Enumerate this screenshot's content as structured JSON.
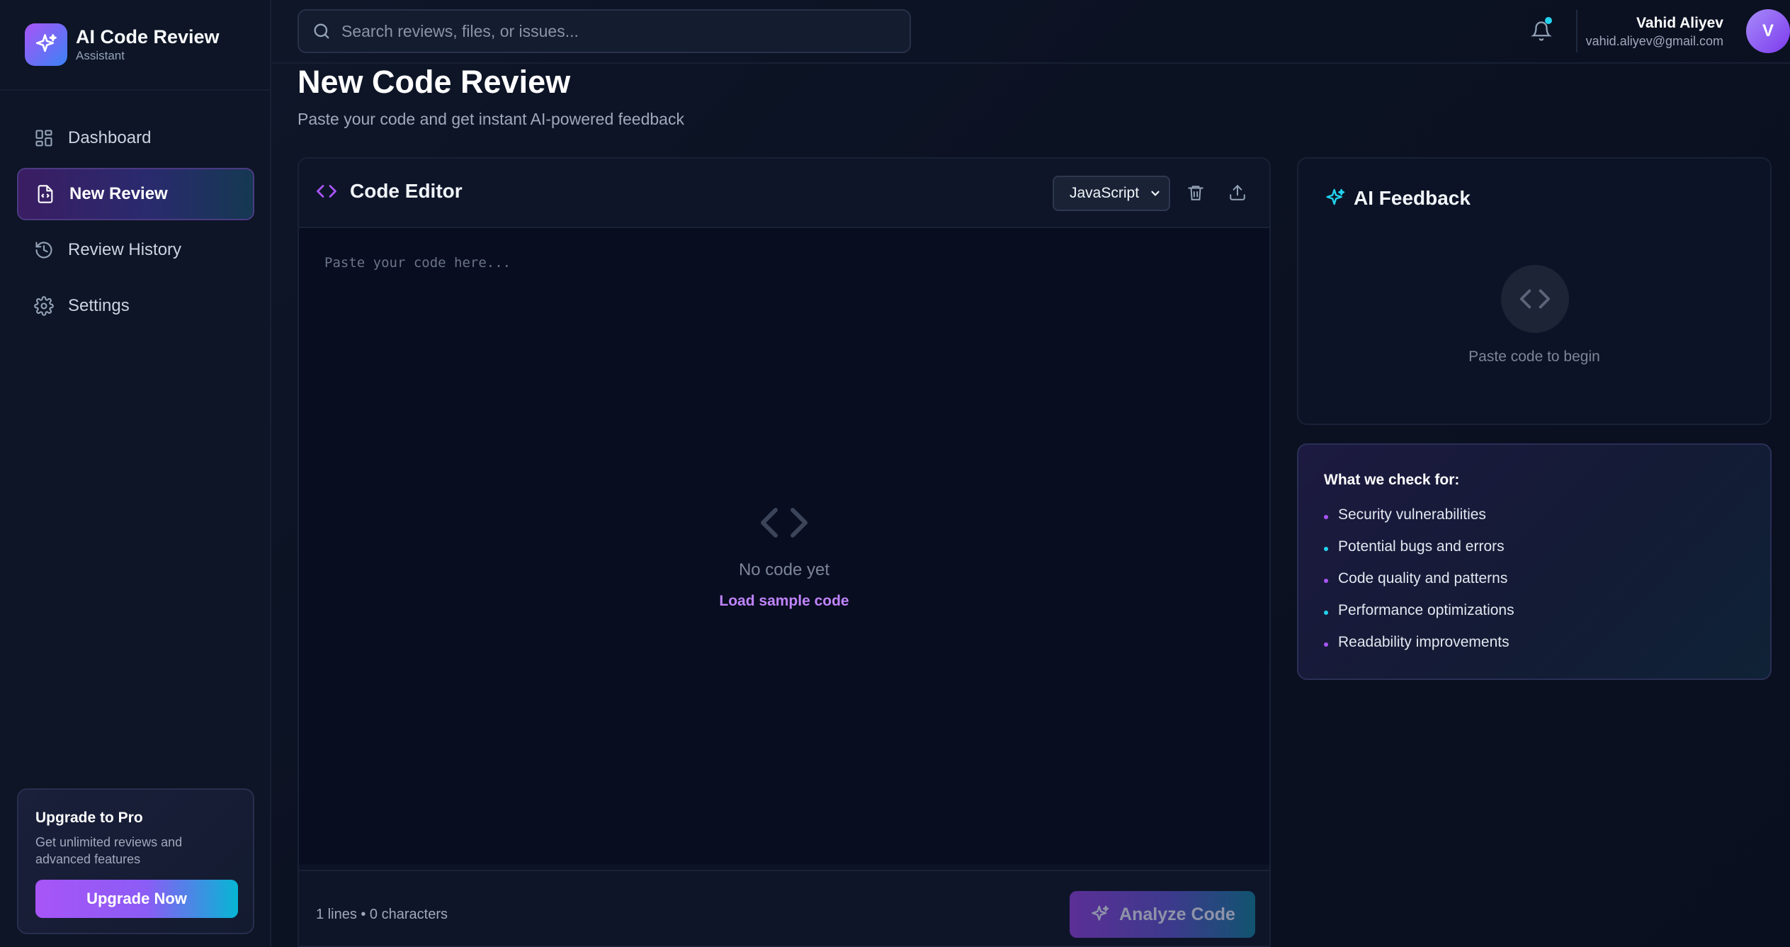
{
  "brand": {
    "title": "AI Code Review",
    "subtitle": "Assistant"
  },
  "sidebar": {
    "items": [
      {
        "label": "Dashboard",
        "icon": "dashboard-icon",
        "active": false
      },
      {
        "label": "New Review",
        "icon": "file-code-icon",
        "active": true
      },
      {
        "label": "Review History",
        "icon": "history-icon",
        "active": false
      },
      {
        "label": "Settings",
        "icon": "gear-icon",
        "active": false
      }
    ],
    "upgrade": {
      "title": "Upgrade to Pro",
      "description": "Get unlimited reviews and advanced features",
      "button_label": "Upgrade Now"
    }
  },
  "topbar": {
    "search_placeholder": "Search reviews, files, or issues...",
    "user": {
      "name": "Vahid Aliyev",
      "email": "vahid.aliyev@gmail.com",
      "initial": "V"
    }
  },
  "main": {
    "title": "New Code Review",
    "subtitle": "Paste your code and get instant AI-powered feedback"
  },
  "editor": {
    "title": "Code Editor",
    "language": "JavaScript",
    "placeholder": "Paste your code here...",
    "empty_title": "No code yet",
    "empty_link": "Load sample code",
    "stats": "1 lines • 0 characters",
    "analyze_label": "Analyze Code"
  },
  "feedback": {
    "title": "AI Feedback",
    "empty_text": "Paste code to begin"
  },
  "checks": {
    "title": "What we check for:",
    "items": [
      "Security vulnerabilities",
      "Potential bugs and errors",
      "Code quality and patterns",
      "Performance optimizations",
      "Readability improvements"
    ]
  },
  "colors": {
    "accent_purple": "#a855f7",
    "accent_cyan": "#06b6d4",
    "background": "#0b1120",
    "link": "#c084fc"
  }
}
